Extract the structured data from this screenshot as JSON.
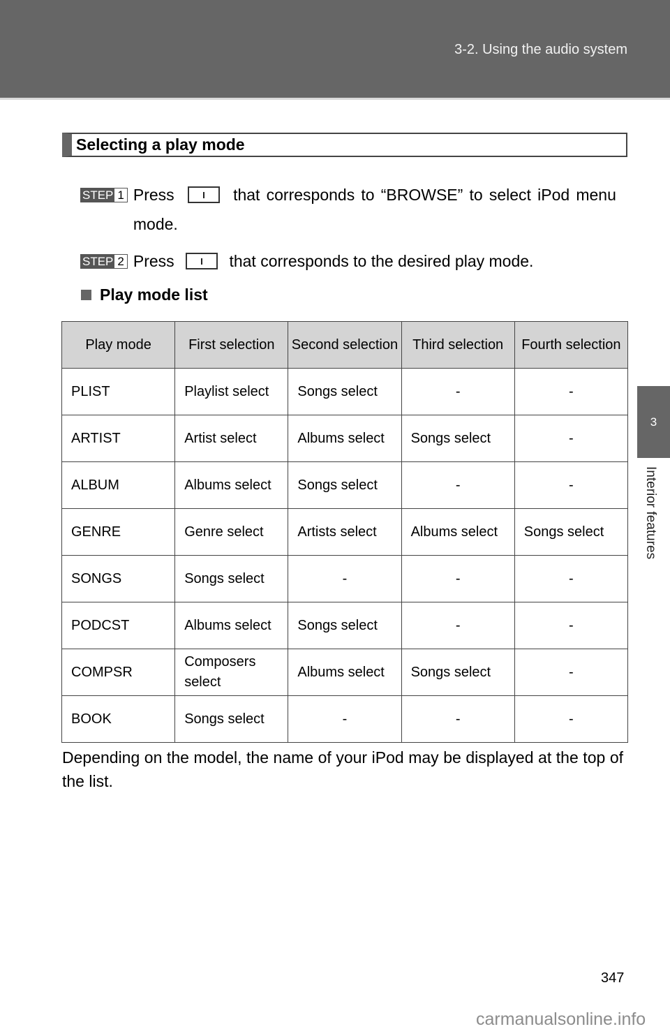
{
  "header": {
    "section": "3-2. Using the audio system"
  },
  "side_tab": {
    "chapter_number": "3",
    "chapter_title": "Interior features"
  },
  "section_heading": "Selecting a play mode",
  "steps": [
    {
      "badge_label": "STEP",
      "badge_number": "1",
      "text_before": "Press",
      "button_icon": "button-1-icon",
      "text_after": "that corresponds to “BROWSE” to select iPod menu mode."
    },
    {
      "badge_label": "STEP",
      "badge_number": "2",
      "text_before": "Press",
      "button_icon": "button-1-icon",
      "text_after": "that corresponds to the desired play mode."
    }
  ],
  "subheading": "Play mode list",
  "table": {
    "headers": [
      "Play mode",
      "First selection",
      "Second selection",
      "Third selection",
      "Fourth selection"
    ],
    "rows": [
      [
        "PLIST",
        "Playlist select",
        "Songs select",
        "-",
        "-"
      ],
      [
        "ARTIST",
        "Artist select",
        "Albums select",
        "Songs select",
        "-"
      ],
      [
        "ALBUM",
        "Albums select",
        "Songs select",
        "-",
        "-"
      ],
      [
        "GENRE",
        "Genre select",
        "Artists select",
        "Albums select",
        "Songs select"
      ],
      [
        "SONGS",
        "Songs select",
        "-",
        "-",
        "-"
      ],
      [
        "PODCST",
        "Albums select",
        "Songs select",
        "-",
        "-"
      ],
      [
        "COMPSR",
        "Composers select",
        "Albums select",
        "Songs select",
        "-"
      ],
      [
        "BOOK",
        "Songs select",
        "-",
        "-",
        "-"
      ]
    ]
  },
  "note": "Depending on the model, the name of your iPod may be displayed at the top of the list.",
  "page_number": "347",
  "watermark": "carmanualsonline.info",
  "colors": {
    "banner": "#666666",
    "header_cell": "#d4d4d4",
    "watermark": "#8c8c8c"
  }
}
